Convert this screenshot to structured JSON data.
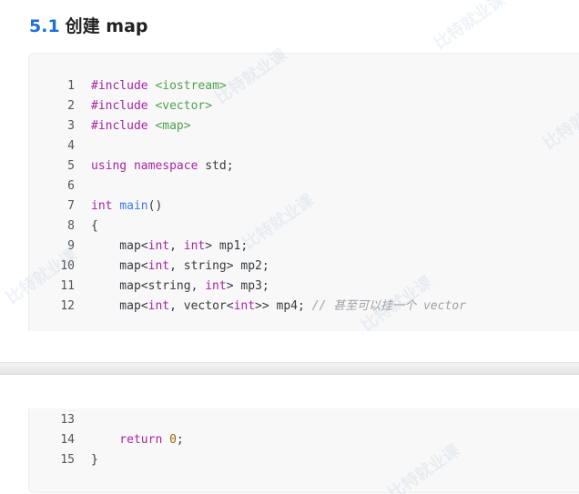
{
  "heading": {
    "number": "5.1",
    "title": "创建 map"
  },
  "code_block_1": [
    {
      "n": "1",
      "tokens": [
        {
          "t": "#include ",
          "c": "kw-pre"
        },
        {
          "t": "<iostream>",
          "c": "str"
        }
      ]
    },
    {
      "n": "2",
      "tokens": [
        {
          "t": "#include ",
          "c": "kw-pre"
        },
        {
          "t": "<vector>",
          "c": "str"
        }
      ]
    },
    {
      "n": "3",
      "tokens": [
        {
          "t": "#include ",
          "c": "kw-pre"
        },
        {
          "t": "<map>",
          "c": "str"
        }
      ]
    },
    {
      "n": "4",
      "tokens": []
    },
    {
      "n": "5",
      "tokens": [
        {
          "t": "using namespace ",
          "c": "kw"
        },
        {
          "t": "std;",
          "c": ""
        }
      ]
    },
    {
      "n": "6",
      "tokens": []
    },
    {
      "n": "7",
      "tokens": [
        {
          "t": "int ",
          "c": "kw"
        },
        {
          "t": "main",
          "c": "fn"
        },
        {
          "t": "()",
          "c": ""
        }
      ]
    },
    {
      "n": "8",
      "tokens": [
        {
          "t": "{",
          "c": ""
        }
      ]
    },
    {
      "n": "9",
      "tokens": [
        {
          "t": "    map<",
          "c": ""
        },
        {
          "t": "int",
          "c": "kw"
        },
        {
          "t": ", ",
          "c": ""
        },
        {
          "t": "int",
          "c": "kw"
        },
        {
          "t": "> mp1;",
          "c": ""
        }
      ]
    },
    {
      "n": "10",
      "tokens": [
        {
          "t": "    map<",
          "c": ""
        },
        {
          "t": "int",
          "c": "kw"
        },
        {
          "t": ", string> mp2;",
          "c": ""
        }
      ]
    },
    {
      "n": "11",
      "tokens": [
        {
          "t": "    map<string, ",
          "c": ""
        },
        {
          "t": "int",
          "c": "kw"
        },
        {
          "t": "> mp3;",
          "c": ""
        }
      ]
    },
    {
      "n": "12",
      "tokens": [
        {
          "t": "    map<",
          "c": ""
        },
        {
          "t": "int",
          "c": "kw"
        },
        {
          "t": ", vector<",
          "c": ""
        },
        {
          "t": "int",
          "c": "kw"
        },
        {
          "t": ">> mp4; ",
          "c": ""
        },
        {
          "t": "// 甚至可以挂一个 vector",
          "c": "cmt"
        }
      ]
    }
  ],
  "code_block_2": [
    {
      "n": "13",
      "tokens": []
    },
    {
      "n": "14",
      "tokens": [
        {
          "t": "    return ",
          "c": "kw"
        },
        {
          "t": "0",
          "c": "numlit"
        },
        {
          "t": ";",
          "c": ""
        }
      ]
    },
    {
      "n": "15",
      "tokens": [
        {
          "t": "}",
          "c": ""
        }
      ]
    }
  ],
  "watermark_text": "比特就业课"
}
